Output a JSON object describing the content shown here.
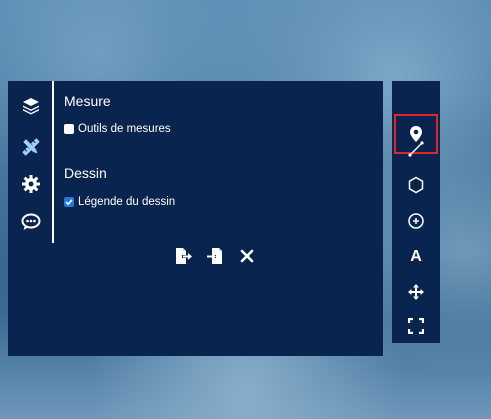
{
  "panel": {
    "sidebar_icons": [
      "layers-icon",
      "ruler-pencil-icon",
      "gear-icon",
      "chat-icon"
    ],
    "mesure": {
      "title": "Mesure",
      "checkbox_label": "Outils de mesures",
      "checked": false
    },
    "dessin": {
      "title": "Dessin",
      "checkbox_label": "Légende du dessin",
      "checked": true
    },
    "actions": [
      "export-icon",
      "import-icon",
      "close-icon"
    ]
  },
  "toolbar": {
    "tools": [
      {
        "name": "marker-tool",
        "active": true
      },
      {
        "name": "line-tool"
      },
      {
        "name": "polygon-tool"
      },
      {
        "name": "circle-tool"
      },
      {
        "name": "text-tool",
        "label": "A"
      },
      {
        "name": "move-tool"
      },
      {
        "name": "fullscreen-tool"
      }
    ],
    "active_outline_color": "#e1232a"
  },
  "colors": {
    "panel_bg": "#0a2450",
    "checkbox_on": "#1e7ae0"
  }
}
